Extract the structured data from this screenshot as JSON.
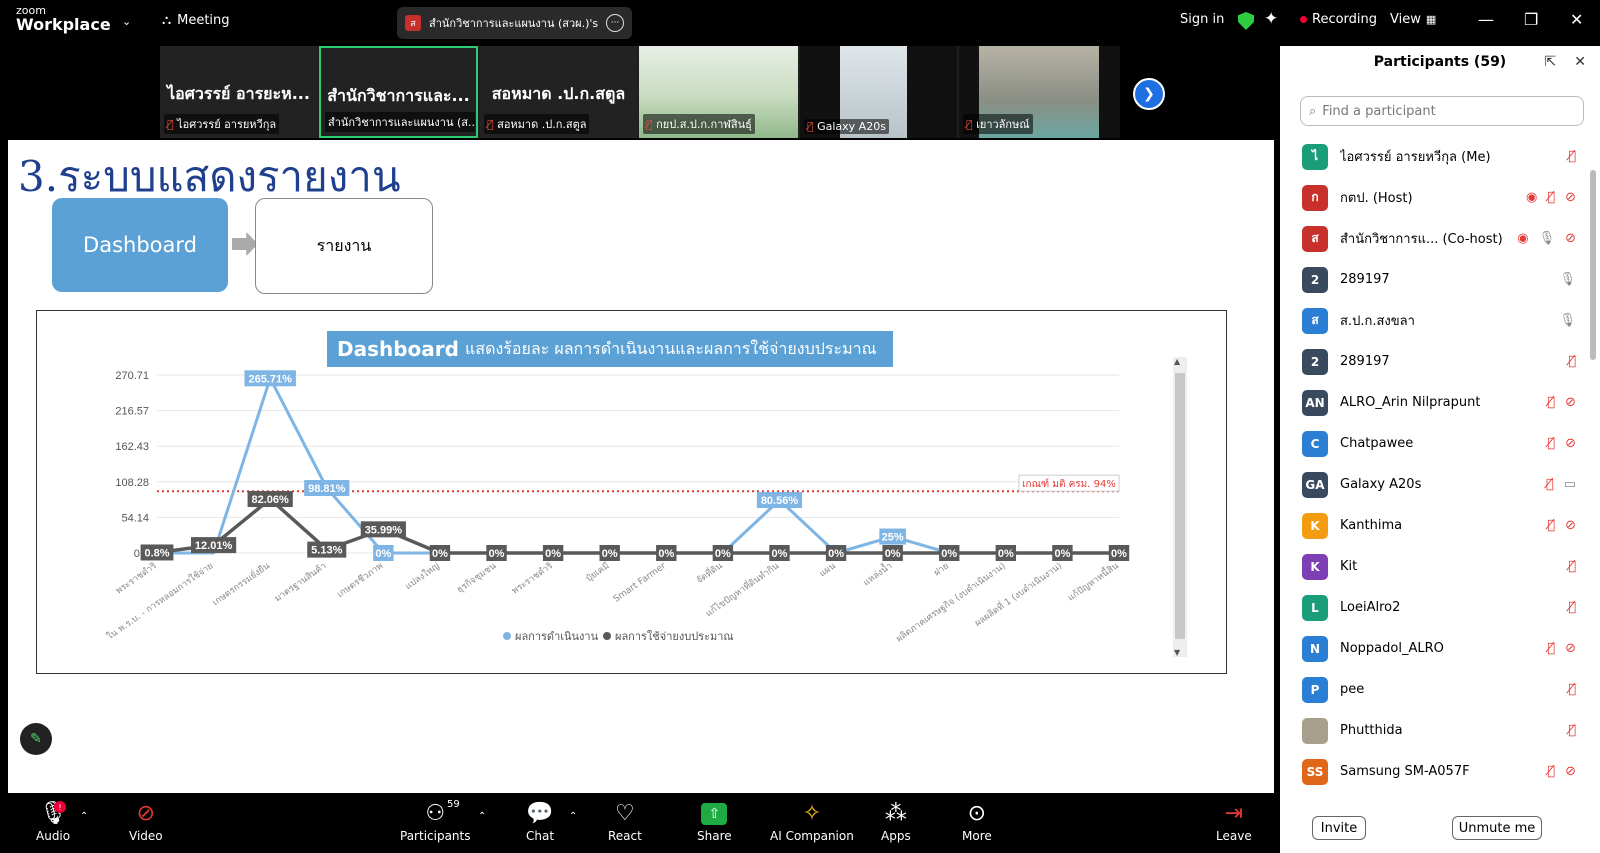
{
  "app": {
    "logo_top": "zoom",
    "logo_bottom": "Workplace",
    "meeting_label": "Meeting",
    "share_tab_avatar": "ส",
    "share_tab_label": "สำนักวิชาการและแผนงาน (สวผ.)'s scr",
    "sign_in": "Sign in",
    "recording": "Recording",
    "view": "View"
  },
  "video_strip": [
    {
      "big": "ไอศวรรย์ อารยะห...",
      "small": "ไอศวรรย์ อารยหวีกุล"
    },
    {
      "big": "สำนักวิชาการและ...",
      "small": "สำนักวิชาการและแผนงาน (ส..."
    },
    {
      "big": "สอหมาด .ป.ก.สตูล",
      "small": "สอหมาด .ป.ก.สตูล"
    },
    {
      "big": "",
      "small": "กยป.ส.ป.ก.กาฬสินธุ์"
    },
    {
      "big": "",
      "small": "Galaxy A20s"
    },
    {
      "big": "",
      "small": "เยาวลักษณ์"
    }
  ],
  "slide": {
    "title": "3.ระบบแสดงรายงาน",
    "dashboard_box": "Dashboard",
    "report_box": "รายงาน",
    "chart_banner_bold": "Dashboard",
    "chart_banner_rest": "แสดงร้อยละ ผลการดำเนินงานและผลการใช้จ่ายงบประมาณ"
  },
  "chart_data": {
    "type": "line",
    "title": "Dashboard แสดงร้อยละ ผลการดำเนินงานและผลการใช้จ่ายงบประมาณ",
    "y_ticks": [
      "270.71",
      "216.57",
      "162.43",
      "108.28",
      "54.14",
      "0.0"
    ],
    "ylim": [
      0,
      270.71
    ],
    "threshold": {
      "value": 94,
      "label": "เกณฑ์ มติ ครม. 94%",
      "color": "#e53935"
    },
    "categories": [
      "พระราชดำริ",
      "ใน พ.ร.บ. - การหลอมการใช้จ่าย",
      "เกษตรกรรมยั่งยืน",
      "มาตรฐานสินค้า",
      "เกษตรชีวภาพ",
      "แปลงใหญ่",
      "ธุรกิจชุมชน",
      "พระราชดำริ",
      "ปุ๋ยเคมี",
      "Smart Farmer",
      "จัดที่ดิน",
      "แก้ไขปัญหาที่ดินทำกิน",
      "แผน",
      "แหล่งน้ำ",
      "ฝาย",
      "ผลิตภาคเศรษฐกิจ (งบดำเนินงาน)",
      "ผลผลิตที่ 1 (งบดำเนินงาน)",
      "แก้ปัญหาหนี้สิน"
    ],
    "series": [
      {
        "name": "ผลการดำเนินงาน",
        "color": "#7fb5e4",
        "values": [
          0,
          0,
          265.71,
          98.81,
          0,
          0,
          0,
          0,
          0,
          0,
          0,
          80.56,
          0,
          25,
          0,
          0,
          0,
          0
        ],
        "labels": [
          "",
          "",
          "265.71%",
          "98.81%",
          "0%",
          "",
          "",
          "",
          "",
          "",
          "",
          "80.56%",
          "",
          "25%",
          "",
          "",
          "",
          ""
        ]
      },
      {
        "name": "ผลการใช้จ่ายงบประมาณ",
        "color": "#595959",
        "values": [
          0.8,
          12.01,
          82.06,
          5.13,
          35.99,
          0,
          0,
          0,
          0,
          0,
          0,
          0,
          0,
          0,
          0,
          0,
          0,
          0
        ],
        "labels": [
          "0.8%",
          "12.01%",
          "82.06%",
          "5.13%",
          "35.99%",
          "0%",
          "0%",
          "0%",
          "0%",
          "0%",
          "0%",
          "0%",
          "0%",
          "0%",
          "0%",
          "0%",
          "0%",
          "0%"
        ]
      }
    ],
    "legend_position": "bottom-center",
    "grid": true
  },
  "participants": {
    "title": "Participants (59)",
    "search_placeholder": "Find a participant",
    "list": [
      {
        "initial": "ไ",
        "name": "ไอศวรรย์ อารยหวีกุล (Me)",
        "color": "#1a9e7a",
        "icons": [
          "mic-off"
        ]
      },
      {
        "initial": "ก",
        "name": "กตป. (Host)",
        "color": "#c8302b",
        "icons": [
          "record",
          "mic-off",
          "video-off"
        ]
      },
      {
        "initial": "ส",
        "name": "สำนักวิชาการแ... (Co-host)",
        "color": "#c8302b",
        "icons": [
          "record",
          "mic-on",
          "video-off"
        ]
      },
      {
        "initial": "2",
        "name": "289197",
        "color": "#3a4a5e",
        "icons": [
          "mic-grey"
        ]
      },
      {
        "initial": "ส",
        "name": "ส.ป.ก.สงขลา",
        "color": "#2a7fd4",
        "icons": [
          "mic-grey"
        ]
      },
      {
        "initial": "2",
        "name": "289197",
        "color": "#3a4a5e",
        "icons": [
          "mic-off"
        ]
      },
      {
        "initial": "AN",
        "name": "ALRO_Arin Nilprapunt",
        "color": "#3a4a5e",
        "icons": [
          "mic-off",
          "video-off"
        ]
      },
      {
        "initial": "C",
        "name": "Chatpawee",
        "color": "#2a7fd4",
        "icons": [
          "mic-off",
          "video-off"
        ]
      },
      {
        "initial": "GA",
        "name": "Galaxy A20s",
        "color": "#3a4a5e",
        "icons": [
          "mic-off",
          "video-on"
        ]
      },
      {
        "initial": "K",
        "name": "Kanthima",
        "color": "#f39c12",
        "icons": [
          "mic-off",
          "video-off"
        ]
      },
      {
        "initial": "K",
        "name": "Kit",
        "color": "#7e3fb5",
        "icons": [
          "mic-off"
        ]
      },
      {
        "initial": "L",
        "name": "LoeiAlro2",
        "color": "#1a9e7a",
        "icons": [
          "mic-off"
        ]
      },
      {
        "initial": "N",
        "name": "Noppadol_ALRO",
        "color": "#2a7fd4",
        "icons": [
          "mic-off",
          "video-off"
        ]
      },
      {
        "initial": "P",
        "name": "pee",
        "color": "#2a7fd4",
        "icons": [
          "mic-off"
        ]
      },
      {
        "initial": "",
        "name": "Phutthida",
        "color": "#a89f8c",
        "icons": [
          "mic-off"
        ]
      },
      {
        "initial": "SS",
        "name": "Samsung SM-A057F",
        "color": "#e0661a",
        "icons": [
          "mic-off",
          "video-off"
        ]
      }
    ],
    "invite": "Invite",
    "unmute_me": "Unmute me"
  },
  "bottom_bar": {
    "audio": "Audio",
    "audio_badge": "!",
    "video": "Video",
    "participants": "Participants",
    "participants_count": "59",
    "chat": "Chat",
    "react": "React",
    "share": "Share",
    "ai_companion": "AI Companion",
    "apps": "Apps",
    "more": "More",
    "leave": "Leave"
  }
}
